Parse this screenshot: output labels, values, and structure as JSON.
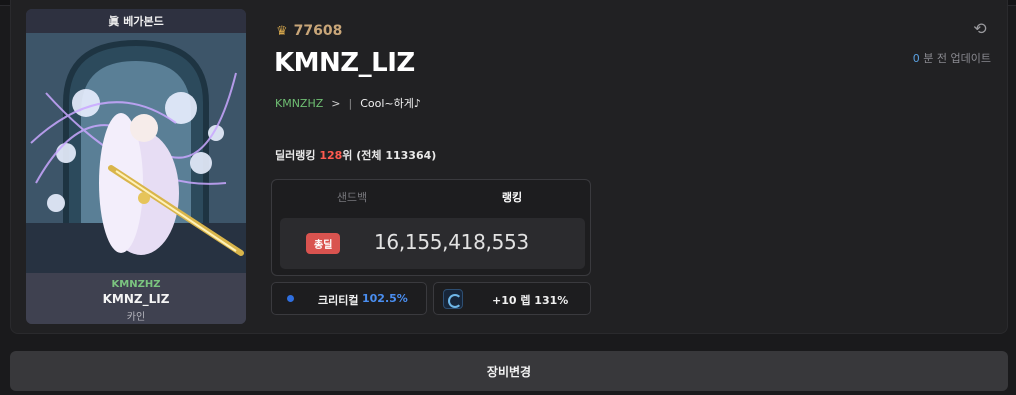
{
  "card": {
    "server_label": "베가본드",
    "server_emblem": "眞",
    "guild": "KMNZHZ",
    "name": "KMNZ_LIZ",
    "class": "카인"
  },
  "profile": {
    "fame": "77608",
    "fame_icon": "fame-crest-icon",
    "name": "KMNZ_LIZ",
    "guild": "KMNZHZ",
    "guild_chevron": ">",
    "separator": "|",
    "adventure": "Cool~하게♪"
  },
  "update": {
    "count": "0",
    "label": "분 전 업데이트"
  },
  "ranking": {
    "prefix": "딜러랭킹",
    "rank": "128",
    "suffix": "위 (전체 113364)"
  },
  "tabs": {
    "sandbag": "샌드백",
    "ranking": "랭킹"
  },
  "damage": {
    "badge": "총딜",
    "value": "16,155,418,553"
  },
  "stats": {
    "crit_label": "크리티컬",
    "crit_value": "102.5%",
    "amp_text": "+10 렙 131%"
  },
  "buttons": {
    "equip_change": "장비변경"
  },
  "colors": {
    "accent_red": "#d9534f",
    "guild_green": "#6fbf73",
    "fame_gold": "#c9a679",
    "crit_blue": "#4a8ef0"
  }
}
